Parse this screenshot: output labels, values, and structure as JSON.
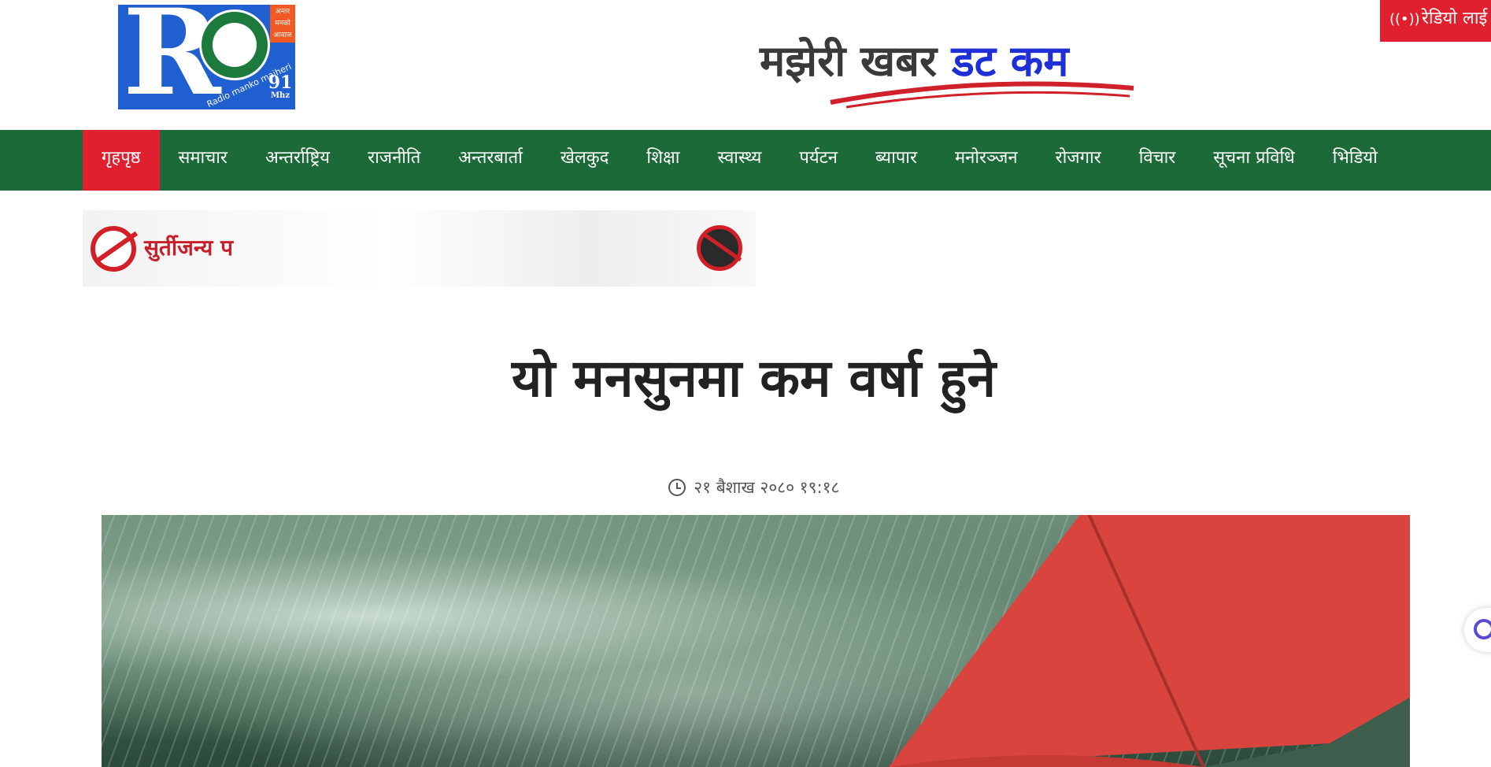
{
  "header": {
    "logo_mhz": "91",
    "logo_unit": "Mhz",
    "logo_script": "Radio manko majheri",
    "logo_tag": "अन्तर मनको आवाज",
    "brand_part1": "मझेरी खबर",
    "brand_part2": "डट कम",
    "radio_live_label": "रेडियो लाई",
    "radio_icon": "broadcast-icon"
  },
  "nav": {
    "items": [
      {
        "label": "गृहपृष्ठ",
        "active": true
      },
      {
        "label": "समाचार"
      },
      {
        "label": "अन्तर्राष्ट्रिय"
      },
      {
        "label": "राजनीति"
      },
      {
        "label": "अन्तरबार्ता"
      },
      {
        "label": "खेलकुद"
      },
      {
        "label": "शिक्षा"
      },
      {
        "label": "स्वास्थ्य"
      },
      {
        "label": "पर्यटन"
      },
      {
        "label": "ब्यापार"
      },
      {
        "label": "मनोरञ्जन"
      },
      {
        "label": "रोजगार"
      },
      {
        "label": "विचार"
      },
      {
        "label": "सूचना प्रविधि"
      },
      {
        "label": "भिडियो"
      }
    ]
  },
  "ad": {
    "text": "सुर्तीजन्य प"
  },
  "article": {
    "headline": "यो मनसुनमा कम वर्षा हुने",
    "timestamp": "२१ बैशाख २०८० १९:१८"
  },
  "colors": {
    "nav_bg": "#1b6a37",
    "accent_red": "#e0202e",
    "brand_blue": "#1e2fd6"
  }
}
